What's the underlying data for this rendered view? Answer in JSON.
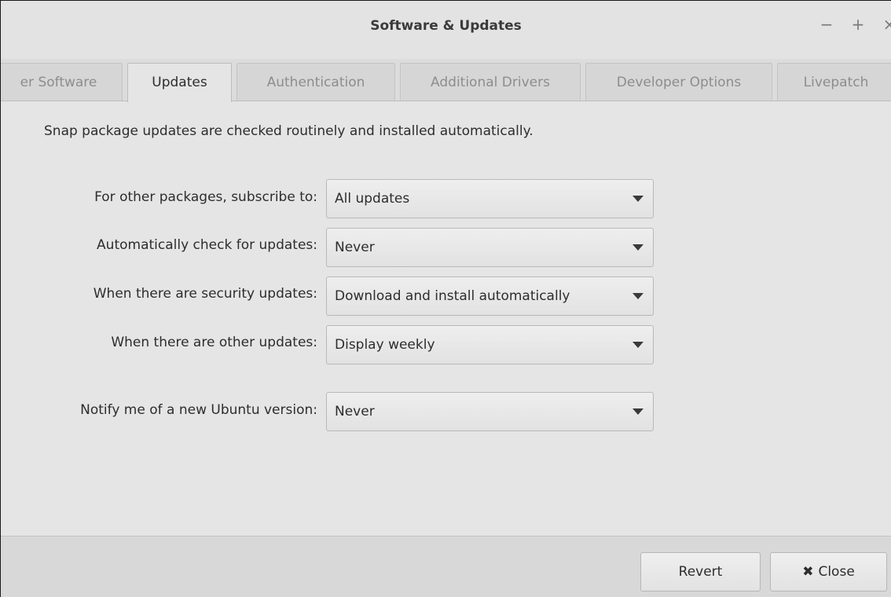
{
  "window": {
    "title": "Software & Updates",
    "controls": {
      "minimize": "−",
      "maximize": "+",
      "close": "×"
    }
  },
  "tabs": [
    {
      "label": "Other Software",
      "visible_text": "er Software",
      "active": false
    },
    {
      "label": "Updates",
      "active": true
    },
    {
      "label": "Authentication",
      "active": false
    },
    {
      "label": "Additional Drivers",
      "active": false
    },
    {
      "label": "Developer Options",
      "active": false
    },
    {
      "label": "Livepatch",
      "active": false
    }
  ],
  "updates": {
    "info": "Snap package updates are checked routinely and installed automatically.",
    "rows": [
      {
        "label": "For other packages, subscribe to:",
        "value": "All updates"
      },
      {
        "label": "Automatically check for updates:",
        "value": "Never"
      },
      {
        "label": "When there are security updates:",
        "value": "Download and install automatically"
      },
      {
        "label": "When there are other updates:",
        "value": "Display weekly"
      },
      {
        "label": "Notify me of a new Ubuntu version:",
        "value": "Never"
      }
    ]
  },
  "footer": {
    "revert_label": "Revert",
    "close_icon": "✖",
    "close_label": "Close"
  }
}
